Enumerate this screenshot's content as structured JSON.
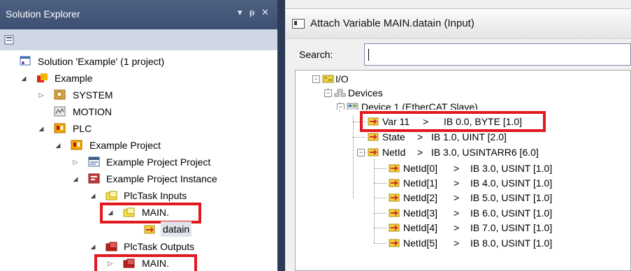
{
  "solution_explorer": {
    "title": "Solution Explorer",
    "pin_glyph": "▾ ᵩ ×",
    "solution_label": "Solution 'Example' (1 project)",
    "tree": [
      {
        "label": "Example",
        "expander": "◢"
      },
      {
        "label": "SYSTEM",
        "expander": "▷"
      },
      {
        "label": "MOTION",
        "expander": ""
      },
      {
        "label": "PLC",
        "expander": "◢"
      },
      {
        "label": "Example Project",
        "expander": "◢"
      },
      {
        "label": "Example Project Project",
        "expander": "▷"
      },
      {
        "label": "Example Project Instance",
        "expander": "◢"
      },
      {
        "label": "PlcTask Inputs",
        "expander": "◢"
      },
      {
        "label": "MAIN.",
        "expander": "◢"
      },
      {
        "label": "datain",
        "expander": ""
      },
      {
        "label": "PlcTask Outputs",
        "expander": "◢"
      },
      {
        "label": "MAIN.",
        "expander": "▷"
      }
    ]
  },
  "attach_dialog": {
    "title": "Attach Variable MAIN.datain (Input)",
    "search_label": "Search:",
    "search_value": "",
    "tree": [
      {
        "label": "I/O"
      },
      {
        "label": "Devices"
      },
      {
        "label": "Device 1 (EtherCAT Slave)"
      },
      {
        "label": "Var 11",
        "address": "IB 0.0, BYTE [1.0]"
      },
      {
        "label": "State",
        "address": "IB 1.0, UINT [2.0]"
      },
      {
        "label": "NetId",
        "address": "IB 3.0, USINTARR6 [6.0]"
      },
      {
        "label": "NetId[0]",
        "address": "IB 3.0, USINT [1.0]"
      },
      {
        "label": "NetId[1]",
        "address": "IB 4.0, USINT [1.0]"
      },
      {
        "label": "NetId[2]",
        "address": "IB 5.0, USINT [1.0]"
      },
      {
        "label": "NetId[3]",
        "address": "IB 6.0, USINT [1.0]"
      },
      {
        "label": "NetId[4]",
        "address": "IB 7.0, USINT [1.0]"
      },
      {
        "label": "NetId[5]",
        "address": "IB 8.0, USINT [1.0]"
      }
    ],
    "arrow": ">"
  },
  "colors": {
    "highlight": "#e0191e",
    "title_bar": "#3d5073"
  }
}
